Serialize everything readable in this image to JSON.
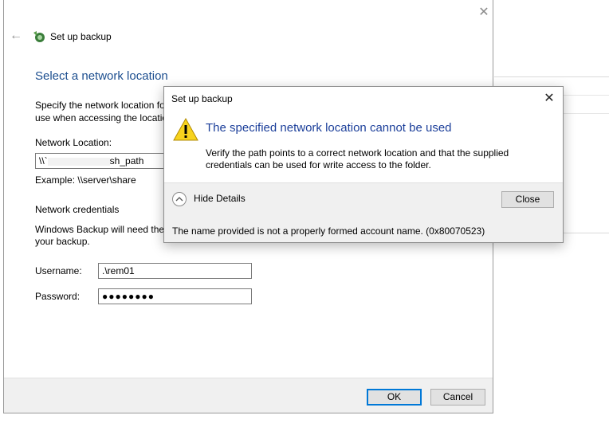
{
  "main_window": {
    "title": "Set up backup",
    "heading": "Select a network location",
    "description": "Specify the network location fo\nuse when accessing the locatio",
    "network_location": {
      "label": "Network Location:",
      "value_prefix": "\\\\`",
      "value_suffix": "sh_path",
      "example": "Example: \\\\server\\share"
    },
    "credentials": {
      "heading": "Network credentials",
      "description_line1": "Windows Backup will need the",
      "description_line2": "your backup.",
      "username_label": "Username:",
      "username_value": ".\\rem01",
      "password_label": "Password:",
      "password_value": "●●●●●●●●"
    },
    "buttons": {
      "ok": "OK",
      "cancel": "Cancel"
    }
  },
  "error_dialog": {
    "title": "Set up backup",
    "heading": "The specified network location cannot be used",
    "body": "Verify the path points to a correct network location and that the supplied credentials can be used for write access to the folder.",
    "toggle_label": "Hide Details",
    "close_button": "Close",
    "details": "The name provided is not a properly formed account name. (0x80070523)"
  },
  "icons": {
    "back": "back-arrow-icon",
    "close": "close-icon",
    "warning": "warning-icon",
    "app": "backup-icon",
    "toggle": "chevron-up-icon"
  },
  "colors": {
    "heading_blue": "#1c4e8f",
    "dialog_heading_blue": "#1c3f9a",
    "focus_blue": "#0078d7",
    "warning_yellow": "#f7d31e"
  }
}
